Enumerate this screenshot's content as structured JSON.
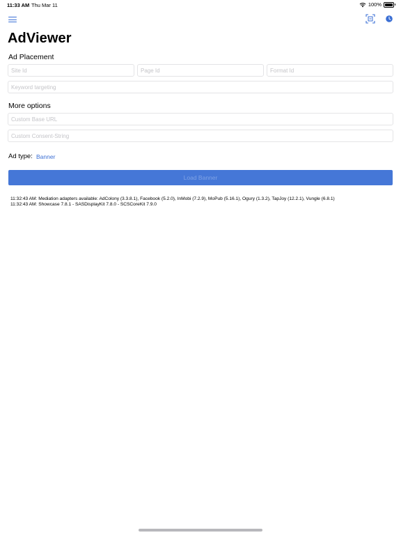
{
  "status_bar": {
    "time": "11:33 AM",
    "date": "Thu Mar 11",
    "battery": "100%",
    "battery_level": 1.0
  },
  "nav": {
    "menu_icon": "hamburger-menu-icon",
    "scan_icon": "qr-scan-icon",
    "history_icon": "clock-icon",
    "accent_color": "#3b6fd4"
  },
  "title": "AdViewer",
  "ad_placement": {
    "heading": "Ad Placement",
    "site_id_placeholder": "Site Id",
    "page_id_placeholder": "Page Id",
    "format_id_placeholder": "Format Id",
    "keyword_placeholder": "Keyword targeting"
  },
  "more_options": {
    "heading": "More options",
    "base_url_placeholder": "Custom Base URL",
    "consent_placeholder": "Custom Consent-String"
  },
  "ad_type": {
    "label": "Ad type:",
    "value": "Banner"
  },
  "load_button": {
    "label": "Load Banner",
    "color": "#4577d7"
  },
  "log": [
    "11:32:43 AM: Mediation adapters available: AdColony (3.3.8.1), Facebook (5.2.0), InMobi (7.2.9), MoPub (5.16.1), Ogury (1.3.2), TapJoy (12.2.1), Vungle (6.8.1)",
    "11:32:43 AM: Showcase 7.8.1 - SASDisplayKit 7.8.0 - SCSCoreKit 7.9.0"
  ]
}
